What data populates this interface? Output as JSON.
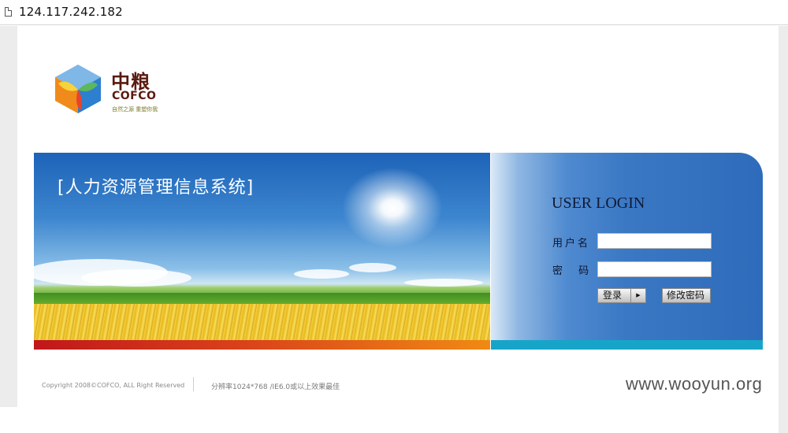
{
  "browser": {
    "url": "124.117.242.182"
  },
  "logo": {
    "name_cn": "中粮",
    "name_en": "COFCO",
    "slogan": "自然之源 重塑你我"
  },
  "banner": {
    "title": "[人力资源管理信息系统]"
  },
  "login": {
    "heading": "USER LOGIN",
    "username_label": "用户名",
    "password_label": "密 码",
    "username_value": "",
    "password_value": "",
    "login_button": "登录",
    "change_password_button": "修改密码"
  },
  "footer": {
    "copyright": "Copyright 2008©COFCO, ALL Right Reserved",
    "resolution_note": "分辨率1024*768 /IE6.0或以上效果最佳"
  },
  "watermark": "www.wooyun.org",
  "colors": {
    "brand_dark": "#5a1a10",
    "panel_blue": "#2e6cbb",
    "stripe_red": "#c0171b",
    "stripe_orange": "#f08a14",
    "stripe_cyan": "#16a5c9"
  }
}
